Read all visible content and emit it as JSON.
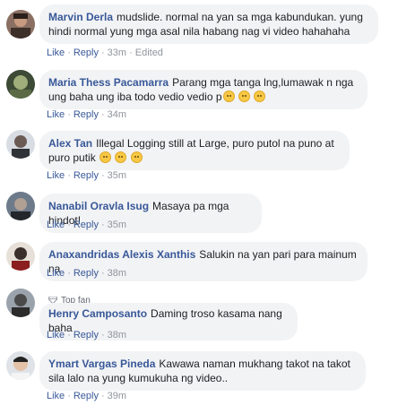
{
  "actions": {
    "like": "Like",
    "reply": "Reply",
    "dot": "·"
  },
  "badge": {
    "top_fan": "Top fan"
  },
  "comments": [
    {
      "name": "Marvin Derla",
      "text": "mudslide. normal na yan sa mga kabundukan. yung hindi normal yung mga asal nila habang nag vi video hahahaha",
      "time": "33m",
      "edited": "Edited"
    },
    {
      "name": "Maria Thess Pacamarra",
      "text": "Parang mga tanga lng,lumawak n nga ung baha ung iba todo vedio vedio p",
      "time": "34m"
    },
    {
      "name": "Alex Tan",
      "text": "Illegal Logging still at Large, puro putol na puno at puro putik",
      "time": "35m"
    },
    {
      "name": "Nanabil Oravla Isug",
      "text": "Masaya pa mga hindot!",
      "time": "35m"
    },
    {
      "name": "Anaxandridas Alexis Xanthis",
      "text": "Salukin na yan pari para mainum na",
      "time": "38m"
    },
    {
      "name": "Henry Camposanto",
      "text": "Daming troso kasama nang baha",
      "time": "38m"
    },
    {
      "name": "Ymart Vargas Pineda",
      "text": "Kawawa naman mukhang takot na takot sila lalo na yung kumukuha ng video..",
      "time": "39m"
    }
  ],
  "colors": {
    "name": "#385898",
    "bubble": "#f2f3f5",
    "meta": "#90949c"
  }
}
